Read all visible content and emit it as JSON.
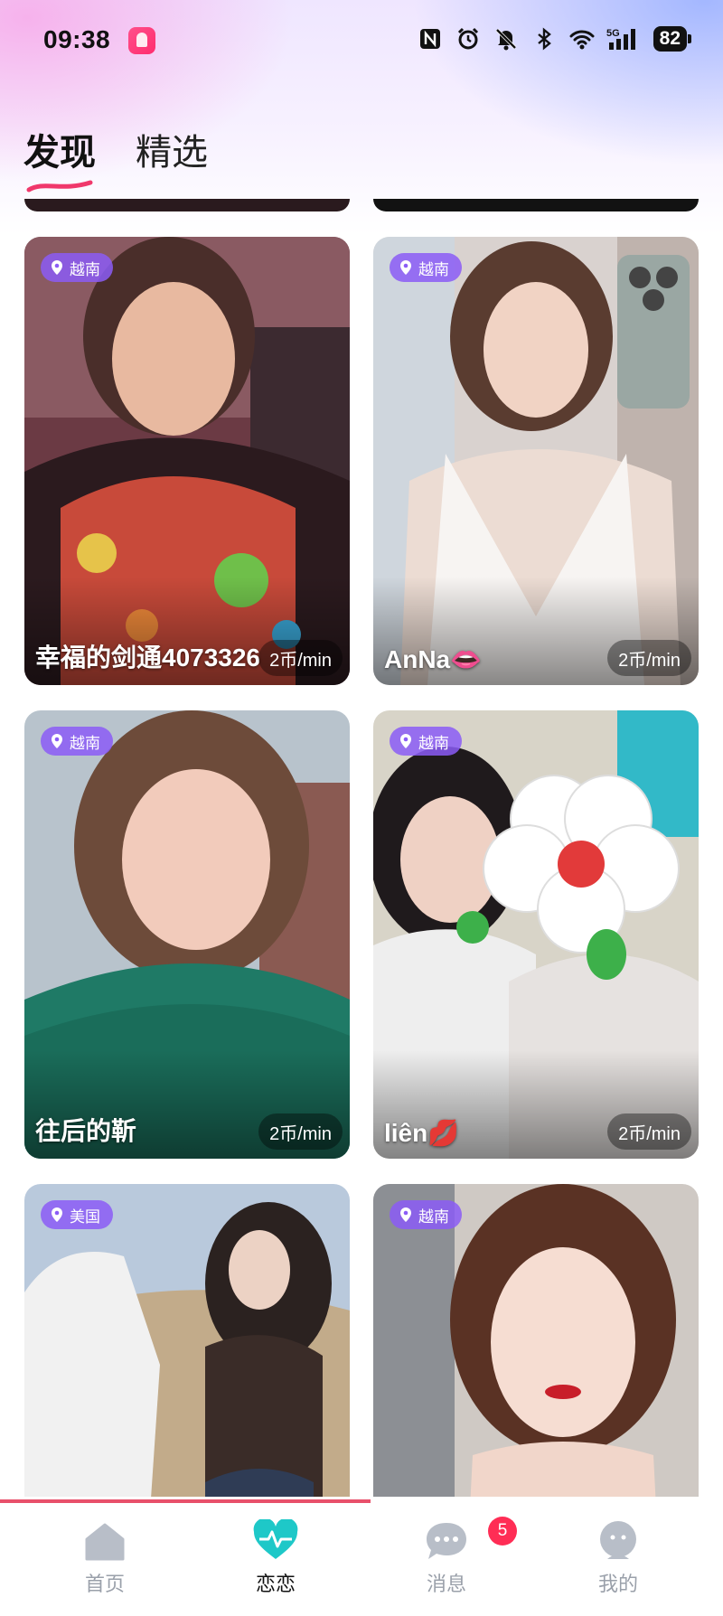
{
  "status_bar": {
    "time": "09:38",
    "battery": "82",
    "network": "5G",
    "icons": [
      "nfc-icon",
      "alarm-icon",
      "mute-bell-icon",
      "bluetooth-icon",
      "wifi-icon",
      "signal-icon"
    ]
  },
  "tabs": [
    {
      "label": "发现",
      "active": true
    },
    {
      "label": "精选",
      "active": false
    }
  ],
  "cards": [
    {
      "location": "越南",
      "name": "幸福的剑通4073326",
      "price": "2币/min"
    },
    {
      "location": "越南",
      "name": "AnNa👄",
      "price": "2币/min"
    },
    {
      "location": "越南",
      "name": "往后的靳",
      "price": "2币/min"
    },
    {
      "location": "越南",
      "name": "liên💋",
      "price": "2币/min"
    },
    {
      "location": "美国",
      "name": "",
      "price": ""
    },
    {
      "location": "越南",
      "name": "",
      "price": ""
    }
  ],
  "bottom_nav": [
    {
      "label": "首页",
      "icon": "home-icon",
      "active": false
    },
    {
      "label": "恋恋",
      "icon": "heartbeat-icon",
      "active": true
    },
    {
      "label": "消息",
      "icon": "chat-bubble-icon",
      "active": false,
      "badge": "5"
    },
    {
      "label": "我的",
      "icon": "profile-icon",
      "active": false
    }
  ],
  "colors": {
    "accent": "#8b5cf6",
    "active_nav": "#1ec8c8",
    "badge": "#ff2d55",
    "scroll_indicator": "#e8506b"
  }
}
